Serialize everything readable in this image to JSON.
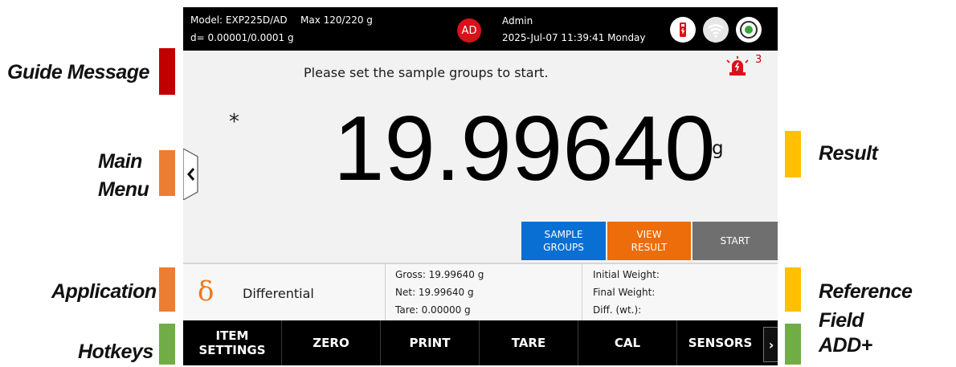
{
  "callouts": {
    "guide_message": "Guide Message",
    "main_menu_line1": "Main",
    "main_menu_line2": "Menu",
    "application": "Application",
    "hotkeys": "Hotkeys",
    "result": "Result",
    "reference_field": "Reference Field",
    "add_plus": "ADD+"
  },
  "colors": {
    "guide": "#c00000",
    "menu": "#ed7d31",
    "application": "#ed7d31",
    "hotkeys": "#70ad47",
    "result": "#ffc000",
    "reference": "#ffc000",
    "add": "#70ad47"
  },
  "status_bar": {
    "model": "Model: EXP225D/AD",
    "max": "Max 120/220 g",
    "d_value": "d= 0.00001/0.0001 g",
    "avatar_initials": "AD",
    "user": "Admin",
    "datetime": "2025-Jul-07 11:39:41 Monday",
    "icons": [
      "usb-icon",
      "wifi-icon",
      "level-icon"
    ]
  },
  "guide_message": "Please set the sample groups to start.",
  "alarm": {
    "icon": "alarm-icon",
    "count": "3"
  },
  "result": {
    "stability_mark": "*",
    "weight": "19.99640",
    "unit": "g"
  },
  "actions": {
    "sample_groups_line1": "SAMPLE",
    "sample_groups_line2": "GROUPS",
    "view_result_line1": "VIEW",
    "view_result_line2": "RESULT",
    "start": "START"
  },
  "application": {
    "symbol": "δ",
    "label": "Differential"
  },
  "weights": {
    "gross": "Gross: 19.99640 g",
    "net": "Net: 19.99640 g",
    "tare": "Tare: 0.00000 g"
  },
  "reference_field": {
    "initial": "Initial Weight:",
    "final": "Final Weight:",
    "diff": "Diff. (wt.):"
  },
  "hotkeys": {
    "item_settings_line1": "ITEM",
    "item_settings_line2": "SETTINGS",
    "zero": "ZERO",
    "print": "PRINT",
    "tare": "TARE",
    "cal": "CAL",
    "sensors": "SENSORS"
  }
}
